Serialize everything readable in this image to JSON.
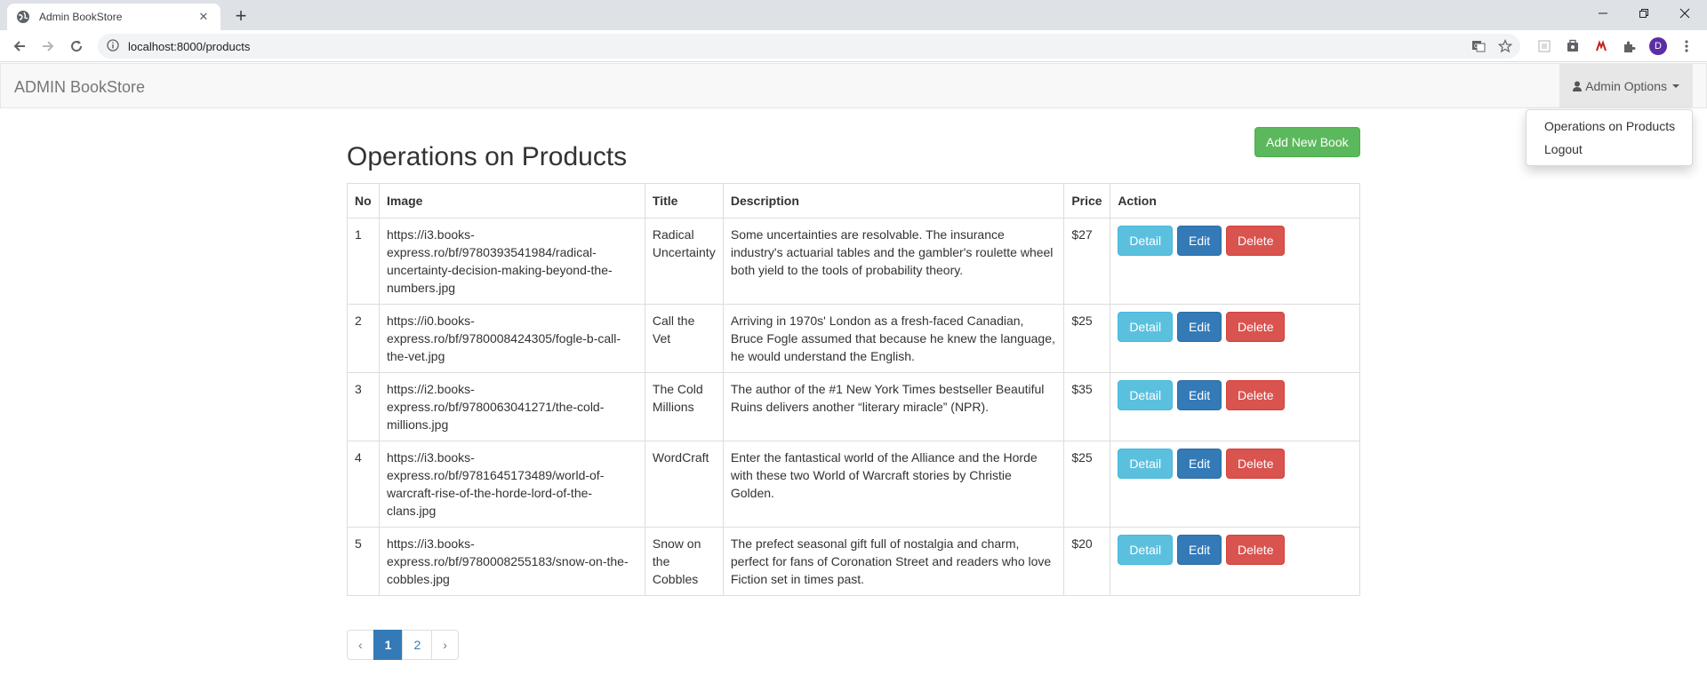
{
  "browser": {
    "tab_title": "Admin BookStore",
    "tab_close": "✕",
    "new_tab": "+",
    "url": "localhost:8000/products",
    "profile_initial": "D"
  },
  "navbar": {
    "brand": "ADMIN BookStore",
    "admin_options": "Admin Options",
    "dropdown": {
      "items": [
        "Operations on Products",
        "Logout"
      ]
    }
  },
  "main": {
    "heading": "Operations on Products",
    "add_button": "Add New Book",
    "table": {
      "headers": [
        "No",
        "Image",
        "Title",
        "Description",
        "Price",
        "Action"
      ],
      "rows": [
        {
          "no": "1",
          "image": "https://i3.books-express.ro/bf/9780393541984/radical-uncertainty-decision-making-beyond-the-numbers.jpg",
          "title": "Radical Uncertainty",
          "description": "Some uncertainties are resolvable. The insurance industry's actuarial tables and the gambler's roulette wheel both yield to the tools of probability theory.",
          "price": "$27"
        },
        {
          "no": "2",
          "image": "https://i0.books-express.ro/bf/9780008424305/fogle-b-call-the-vet.jpg",
          "title": "Call the Vet",
          "description": "Arriving in 1970s' London as a fresh-faced Canadian, Bruce Fogle assumed that because he knew the language, he would understand the English.",
          "price": "$25"
        },
        {
          "no": "3",
          "image": "https://i2.books-express.ro/bf/9780063041271/the-cold-millions.jpg",
          "title": "The Cold Millions",
          "description": "The author of the #1 New York Times bestseller Beautiful Ruins delivers another “literary miracle” (NPR).",
          "price": "$35"
        },
        {
          "no": "4",
          "image": "https://i3.books-express.ro/bf/9781645173489/world-of-warcraft-rise-of-the-horde-lord-of-the-clans.jpg",
          "title": "WordCraft",
          "description": "Enter the fantastical world of the Alliance and the Horde with these two World of Warcraft stories by Christie Golden.",
          "price": "$25"
        },
        {
          "no": "5",
          "image": "https://i3.books-express.ro/bf/9780008255183/snow-on-the-cobbles.jpg",
          "title": "Snow on the Cobbles",
          "description": "The prefect seasonal gift full of nostalgia and charm, perfect for fans of Coronation Street and readers who love Fiction set in times past.",
          "price": "$20"
        }
      ],
      "action_labels": {
        "detail": "Detail",
        "edit": "Edit",
        "delete": "Delete"
      }
    },
    "pagination": {
      "prev": "‹",
      "pages": [
        "1",
        "2"
      ],
      "current": "1",
      "next": "›"
    }
  },
  "colors": {
    "success": "#5cb85c",
    "info": "#5bc0de",
    "primary": "#337ab7",
    "danger": "#d9534f"
  }
}
